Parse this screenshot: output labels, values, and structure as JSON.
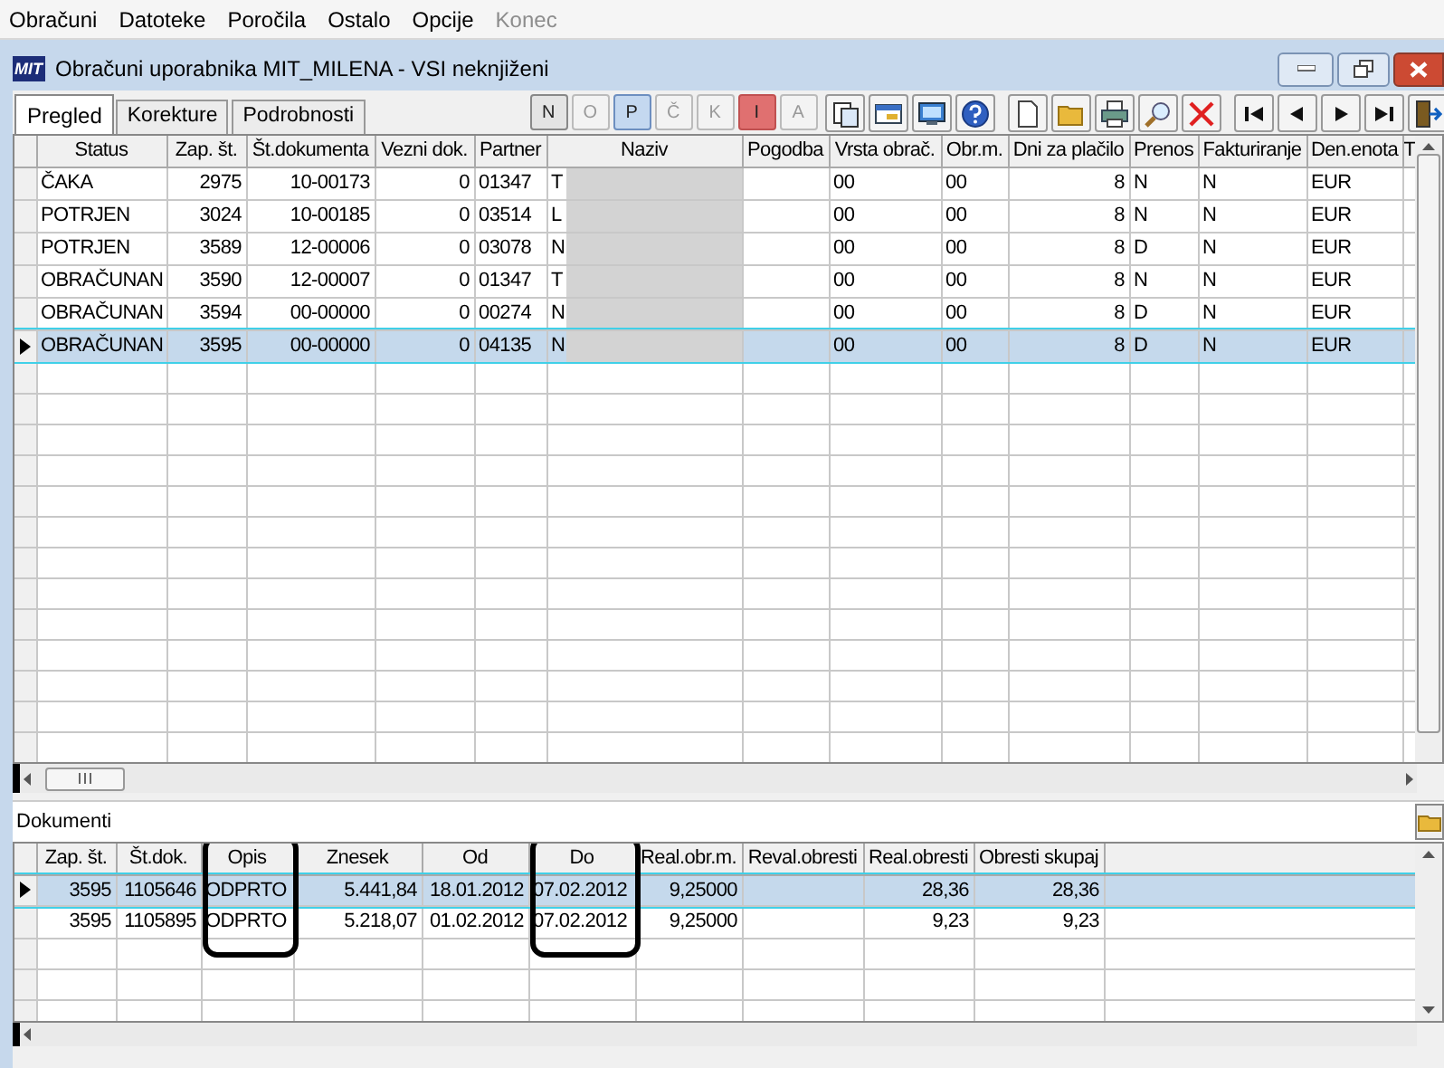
{
  "menu": [
    {
      "label": "Obračuni",
      "disabled": false
    },
    {
      "label": "Datoteke",
      "disabled": false
    },
    {
      "label": "Poročila",
      "disabled": false
    },
    {
      "label": "Ostalo",
      "disabled": false
    },
    {
      "label": "Opcije",
      "disabled": false
    },
    {
      "label": "Konec",
      "disabled": true
    }
  ],
  "window": {
    "logo": "MIT",
    "title": "Obračuni uporabnika MIT_MILENA - VSI neknjiženi"
  },
  "tabs": [
    {
      "label": "Pregled",
      "selected": true
    },
    {
      "label": "Korekture",
      "selected": false
    },
    {
      "label": "Podrobnosti",
      "selected": false
    }
  ],
  "filter_buttons": [
    {
      "label": "N",
      "pressed": false,
      "disabled": false,
      "highlighted": false
    },
    {
      "label": "O",
      "pressed": false,
      "disabled": true,
      "highlighted": false
    },
    {
      "label": "P",
      "pressed": true,
      "disabled": false,
      "highlighted": false
    },
    {
      "label": "Č",
      "pressed": false,
      "disabled": true,
      "highlighted": false
    },
    {
      "label": "K",
      "pressed": false,
      "disabled": true,
      "highlighted": false
    },
    {
      "label": "I",
      "pressed": false,
      "disabled": false,
      "highlighted": true
    },
    {
      "label": "A",
      "pressed": false,
      "disabled": true,
      "highlighted": false
    }
  ],
  "main_table": {
    "columns": [
      "Status",
      "Zap. št.",
      "Št.dokumenta",
      "Vezni dok.",
      "Partner",
      "Naziv",
      "Pogodba",
      "Vrsta obrač.",
      "Obr.m.",
      "Dni za plačilo",
      "Prenos",
      "Fakturiranje",
      "Den.enota",
      "T"
    ],
    "rows": [
      {
        "selected": false,
        "cells": [
          "ČAKA",
          "2975",
          "10-00173",
          "0",
          "01347",
          "T",
          "",
          "00",
          "00",
          "8",
          "N",
          "N",
          "EUR",
          ""
        ]
      },
      {
        "selected": false,
        "cells": [
          "POTRJEN",
          "3024",
          "10-00185",
          "0",
          "03514",
          "L",
          "",
          "00",
          "00",
          "8",
          "N",
          "N",
          "EUR",
          ""
        ]
      },
      {
        "selected": false,
        "cells": [
          "POTRJEN",
          "3589",
          "12-00006",
          "0",
          "03078",
          "N",
          "",
          "00",
          "00",
          "8",
          "D",
          "N",
          "EUR",
          ""
        ]
      },
      {
        "selected": false,
        "cells": [
          "OBRAČUNAN",
          "3590",
          "12-00007",
          "0",
          "01347",
          "T",
          "",
          "00",
          "00",
          "8",
          "N",
          "N",
          "EUR",
          ""
        ]
      },
      {
        "selected": false,
        "cells": [
          "OBRAČUNAN",
          "3594",
          "00-00000",
          "0",
          "00274",
          "N",
          "",
          "00",
          "00",
          "8",
          "D",
          "N",
          "EUR",
          ""
        ]
      },
      {
        "selected": true,
        "cells": [
          "OBRAČUNAN",
          "3595",
          "00-00000",
          "0",
          "04135",
          "N",
          "",
          "00",
          "00",
          "8",
          "D",
          "N",
          "EUR",
          ""
        ]
      }
    ]
  },
  "documents": {
    "title": "Dokumenti",
    "columns": [
      {
        "label": "Zap. št.",
        "circled": false
      },
      {
        "label": "Št.dok.",
        "circled": false
      },
      {
        "label": "Opis",
        "circled": true
      },
      {
        "label": "Znesek",
        "circled": false
      },
      {
        "label": "Od",
        "circled": false
      },
      {
        "label": "Do",
        "circled": true
      },
      {
        "label": "Real.obr.m.",
        "circled": false
      },
      {
        "label": "Reval.obresti",
        "circled": false
      },
      {
        "label": "Real.obresti",
        "circled": false
      },
      {
        "label": "Obresti skupaj",
        "circled": false
      }
    ],
    "rows": [
      {
        "selected": true,
        "cells": [
          "3595",
          "1105646",
          "ODPRTO",
          "5.441,84",
          "18.01.2012",
          "07.02.2012",
          "9,25000",
          "",
          "28,36",
          "28,36"
        ]
      },
      {
        "selected": false,
        "cells": [
          "3595",
          "1105895",
          "ODPRTO",
          "5.218,07",
          "01.02.2012",
          "07.02.2012",
          "9,25000",
          "",
          "9,23",
          "9,23"
        ]
      }
    ]
  }
}
